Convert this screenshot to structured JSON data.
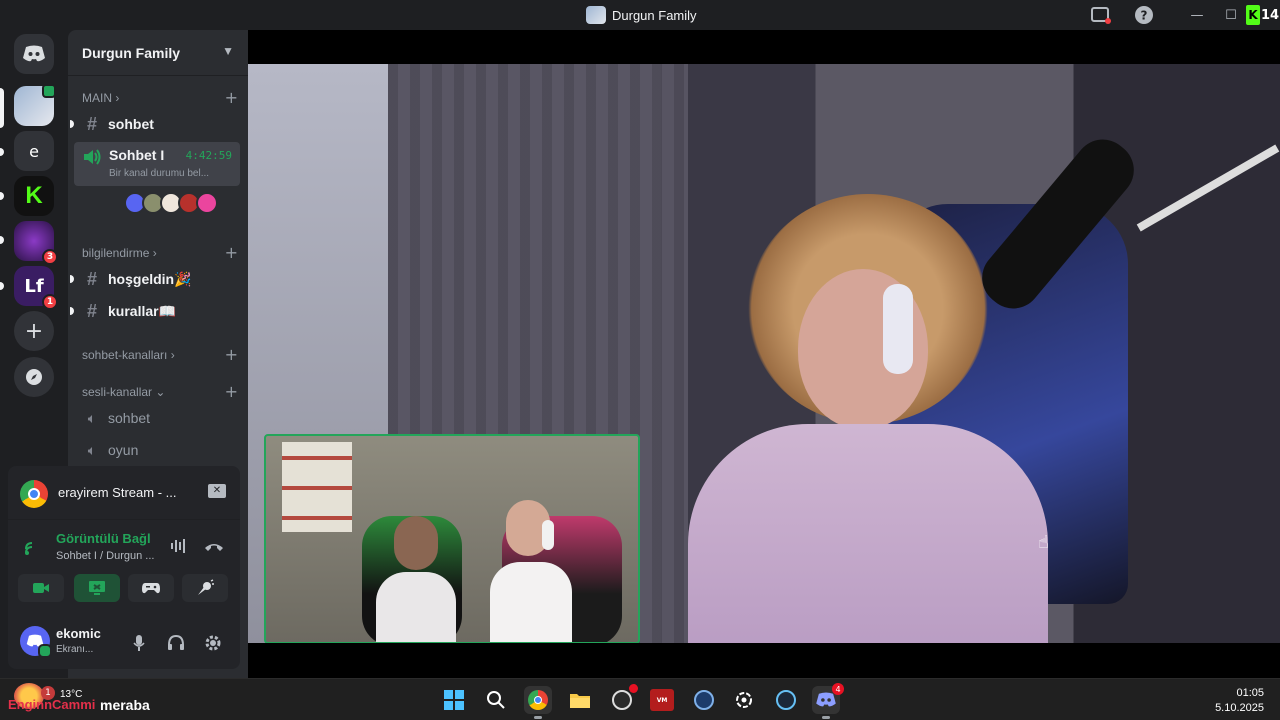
{
  "window": {
    "title": "Durgun Family",
    "controls": {
      "minimize": "—",
      "maximize": "☐",
      "close": "✕"
    },
    "corner_badge": "14"
  },
  "rail": {
    "badges": {
      "server_dragon": "3",
      "server_lf": "1"
    },
    "letters": {
      "server_e": "e",
      "server_lf": "Lf",
      "add": "+"
    }
  },
  "sidebar": {
    "guild_name": "Durgun Family",
    "categories": {
      "main": "MAIN",
      "bilgilendirme": "bilgilendirme",
      "sohbet_kanallari": "sohbet-kanalları",
      "sesli_kanallar": "sesli-kanallar"
    },
    "channels": {
      "sohbet": "sohbet",
      "hosgeldin": "hoşgeldin🎉",
      "kurallar": "kurallar📖",
      "voice_sohbet": "sohbet",
      "voice_oyun": "oyun"
    },
    "active_voice": {
      "name": "Sohbet I",
      "timer": "4:42:59",
      "status": "Bir kanal durumu bel..."
    }
  },
  "call_panel": {
    "stream_title": "erayirem Stream - ...",
    "connection_label": "Görüntülü Bağl",
    "connection_sub": "Sohbet I / Durgun ...",
    "user_name": "ekomic",
    "user_status": "Ekranı..."
  },
  "taskbar": {
    "weather_badge": "1",
    "temperature": "13°C",
    "watermark": "EnginnCammi",
    "chat_overlay": "meraba",
    "discord_badge": "4",
    "time": "01:05",
    "date": "5.10.2025"
  },
  "colors": {
    "accent_green": "#23a55a",
    "badge_red": "#f23f43",
    "discord_blurple": "#5865f2",
    "kick_green": "#53fc18"
  }
}
